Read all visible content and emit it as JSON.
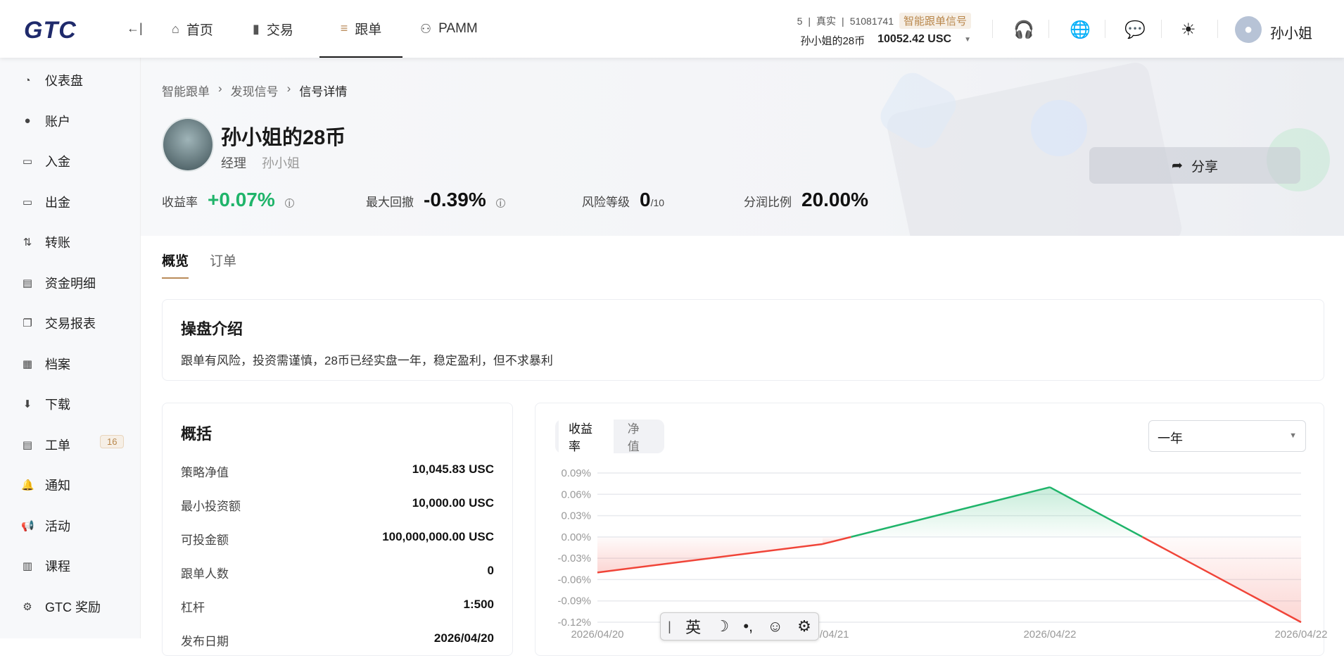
{
  "header": {
    "logo": "GTC",
    "collapse": "←|",
    "nav": [
      {
        "label": "首页",
        "icon": "⌂"
      },
      {
        "label": "交易",
        "icon": "▮"
      },
      {
        "label": "跟单",
        "icon": "≡"
      },
      {
        "label": "PAMM",
        "icon": "⚇"
      }
    ],
    "account": {
      "num": "5",
      "type": "真实",
      "id": "51081741",
      "tag": "智能跟单信号",
      "name": "孙小姐的28币",
      "balance": "10052.42 USC"
    },
    "user": "孙小姐"
  },
  "sidebar": [
    {
      "label": "仪表盘",
      "icon": "◔"
    },
    {
      "label": "账户",
      "icon": "●"
    },
    {
      "label": "入金",
      "icon": "▭"
    },
    {
      "label": "出金",
      "icon": "▭"
    },
    {
      "label": "转账",
      "icon": "⇅"
    },
    {
      "label": "资金明细",
      "icon": "▤"
    },
    {
      "label": "交易报表",
      "icon": "❐"
    },
    {
      "label": "档案",
      "icon": "▦"
    },
    {
      "label": "下载",
      "icon": "⬇"
    },
    {
      "label": "工单",
      "icon": "▤",
      "badge": "16"
    },
    {
      "label": "通知",
      "icon": "🔔"
    },
    {
      "label": "活动",
      "icon": "📢"
    },
    {
      "label": "课程",
      "icon": "▥"
    },
    {
      "label": "GTC 奖励",
      "icon": "⚙"
    }
  ],
  "breadcrumb": [
    "智能跟单",
    "发现信号",
    "信号详情"
  ],
  "profile": {
    "title": "孙小姐的28币",
    "role": "经理",
    "manager": "孙小姐",
    "share": "分享"
  },
  "stats": [
    {
      "label": "收益率",
      "value": "+0.07%",
      "color": "#1fb46a"
    },
    {
      "label": "最大回撤",
      "value": "-0.39%"
    },
    {
      "label": "风险等级",
      "value": "0",
      "suffix": "/10"
    },
    {
      "label": "分润比例",
      "value": "20.00%"
    }
  ],
  "tabs": [
    "概览",
    "订单"
  ],
  "intro": {
    "title": "操盘介绍",
    "text": "跟单有风险，投资需谨慎，28币已经实盘一年，稳定盈利，但不求暴利"
  },
  "overview": {
    "title": "概括",
    "rows": [
      {
        "k": "策略净值",
        "v": "10,045.83 USC"
      },
      {
        "k": "最小投资额",
        "v": "10,000.00 USC"
      },
      {
        "k": "可投金额",
        "v": "100,000,000.00 USC"
      },
      {
        "k": "跟单人数",
        "v": "0"
      },
      {
        "k": "杠杆",
        "v": "1:500"
      },
      {
        "k": "发布日期",
        "v": "2026/04/20"
      }
    ]
  },
  "chart_controls": {
    "seg": [
      "收益率",
      "净值"
    ],
    "range": "一年"
  },
  "chart_data": {
    "type": "line",
    "x": [
      "2026/04/20",
      "2026/04/21",
      "2026/04/22",
      "2026/04/22"
    ],
    "values": [
      -0.05,
      -0.01,
      0.07,
      -0.12
    ],
    "yticks": [
      "0.09%",
      "0.06%",
      "0.03%",
      "0.00%",
      "-0.03%",
      "-0.06%",
      "-0.09%",
      "-0.12%"
    ],
    "ylim": [
      -0.12,
      0.09
    ],
    "unit": "%",
    "colors": {
      "up": "#1fb46a",
      "down": "#f04438"
    }
  },
  "ime": [
    "英",
    "☽",
    "•,",
    "☺",
    "⚙"
  ]
}
